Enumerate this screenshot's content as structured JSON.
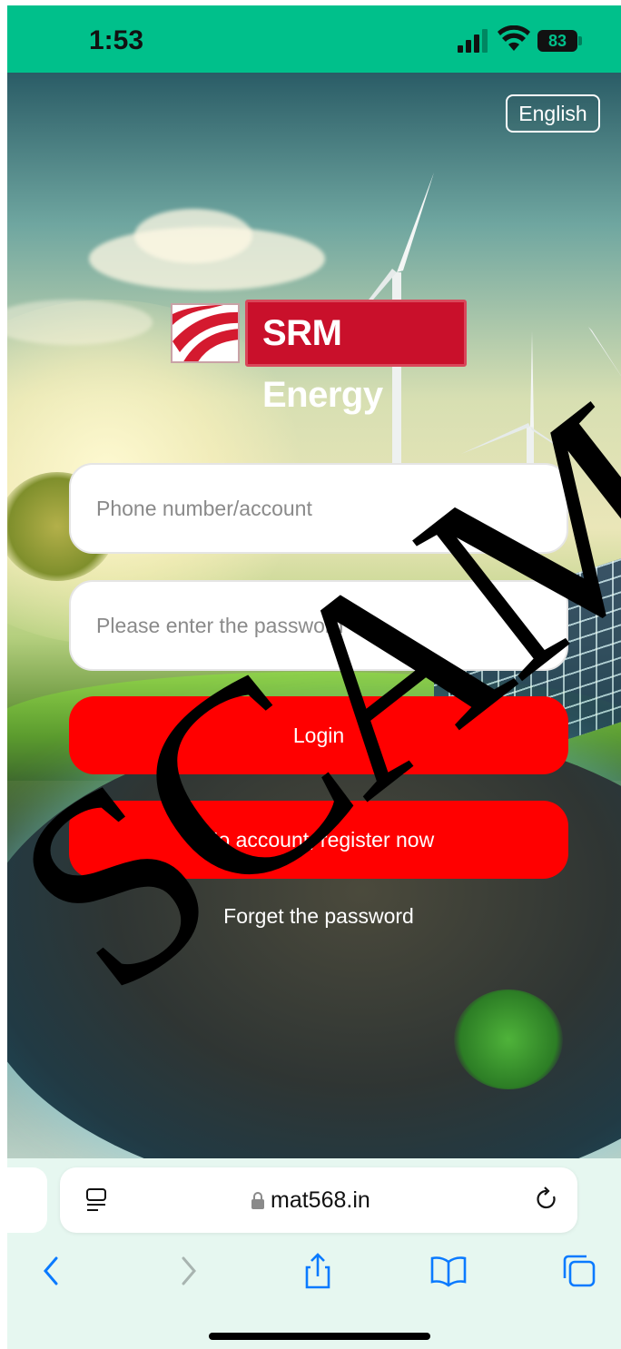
{
  "status_bar": {
    "time": "1:53",
    "battery": "83"
  },
  "header": {
    "language_label": "English"
  },
  "logo": {
    "brand_text": "SRM Energy"
  },
  "form": {
    "phone_placeholder": "Phone number/account",
    "password_placeholder": "Please enter the password",
    "login_label": "Login",
    "register_label": "No account, register now",
    "forget_label": "Forget the password"
  },
  "watermark": {
    "text": "SCAM"
  },
  "browser": {
    "url": "mat568.in"
  },
  "colors": {
    "status_bar": "#00c08b",
    "button": "#ff0000",
    "brand_red": "#c9102b"
  }
}
